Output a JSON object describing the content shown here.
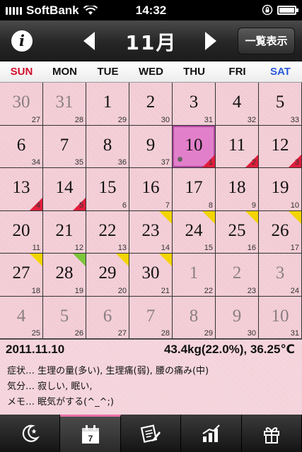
{
  "status_bar": {
    "carrier": "SoftBank",
    "time": "14:32"
  },
  "nav": {
    "month": "11月",
    "list_button": "一覧表示"
  },
  "weekdays": [
    "SUN",
    "MON",
    "TUE",
    "WED",
    "THU",
    "FRI",
    "SAT"
  ],
  "calendar": {
    "cells": [
      {
        "day": "30",
        "num": "27",
        "other": true
      },
      {
        "day": "31",
        "num": "28",
        "other": true
      },
      {
        "day": "1",
        "num": "29"
      },
      {
        "day": "2",
        "num": "30"
      },
      {
        "day": "3",
        "num": "31"
      },
      {
        "day": "4",
        "num": "32"
      },
      {
        "day": "5",
        "num": "33"
      },
      {
        "day": "6",
        "num": "34"
      },
      {
        "day": "7",
        "num": "35"
      },
      {
        "day": "8",
        "num": "36"
      },
      {
        "day": "9",
        "num": "37"
      },
      {
        "day": "10",
        "num": "1",
        "selected": true,
        "marker": "red",
        "dot": true
      },
      {
        "day": "11",
        "num": "2",
        "marker": "red"
      },
      {
        "day": "12",
        "num": "3",
        "marker": "red"
      },
      {
        "day": "13",
        "num": "4",
        "marker": "red"
      },
      {
        "day": "14",
        "num": "5",
        "marker": "red"
      },
      {
        "day": "15",
        "num": "6"
      },
      {
        "day": "16",
        "num": "7"
      },
      {
        "day": "17",
        "num": "8"
      },
      {
        "day": "18",
        "num": "9"
      },
      {
        "day": "19",
        "num": "10"
      },
      {
        "day": "20",
        "num": "11"
      },
      {
        "day": "21",
        "num": "12"
      },
      {
        "day": "22",
        "num": "13"
      },
      {
        "day": "23",
        "num": "14",
        "marker": "yellow",
        "top": true
      },
      {
        "day": "24",
        "num": "15",
        "marker": "yellow",
        "top": true
      },
      {
        "day": "25",
        "num": "16",
        "marker": "yellow",
        "top": true
      },
      {
        "day": "26",
        "num": "17",
        "marker": "yellow",
        "top": true
      },
      {
        "day": "27",
        "num": "18",
        "marker": "yellow",
        "top": true
      },
      {
        "day": "28",
        "num": "19",
        "marker": "green",
        "top": true
      },
      {
        "day": "29",
        "num": "20",
        "marker": "yellow",
        "top": true
      },
      {
        "day": "30",
        "num": "21",
        "marker": "yellow",
        "top": true
      },
      {
        "day": "1",
        "num": "22",
        "other": true
      },
      {
        "day": "2",
        "num": "23",
        "other": true
      },
      {
        "day": "3",
        "num": "24",
        "other": true
      },
      {
        "day": "4",
        "num": "25",
        "other": true
      },
      {
        "day": "5",
        "num": "26",
        "other": true
      },
      {
        "day": "6",
        "num": "27",
        "other": true
      },
      {
        "day": "7",
        "num": "28",
        "other": true
      },
      {
        "day": "8",
        "num": "29",
        "other": true
      },
      {
        "day": "9",
        "num": "30",
        "other": true
      },
      {
        "day": "10",
        "num": "31",
        "other": true
      }
    ]
  },
  "detail": {
    "date": "2011.11.10",
    "measure": "43.4kg(22.0%), 36.25℃",
    "symptoms": "症状… 生理の量(多い), 生理痛(弱), 腰の痛み(中)",
    "mood": "気分… 寂しい, 眠い,",
    "memo": "メモ… 眠気がする(^_^;)"
  },
  "tabs": [
    {
      "icon": "moon-star-icon",
      "active": false
    },
    {
      "icon": "calendar-icon",
      "active": true,
      "label": "7"
    },
    {
      "icon": "note-edit-icon",
      "active": false
    },
    {
      "icon": "bar-chart-icon",
      "active": false
    },
    {
      "icon": "gift-icon",
      "active": false
    }
  ]
}
